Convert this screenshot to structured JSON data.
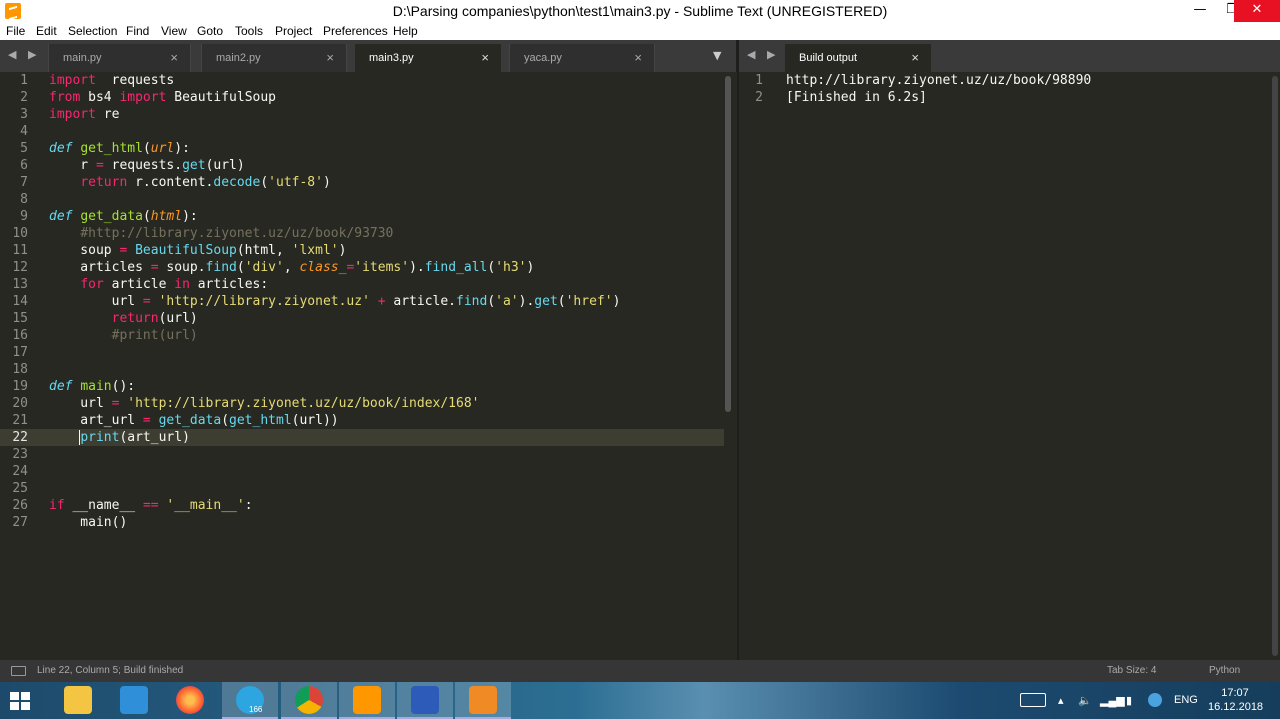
{
  "window": {
    "title": "D:\\Parsing companies\\python\\test1\\main3.py - Sublime Text (UNREGISTERED)",
    "minimize": "—",
    "maximize": "❐",
    "close": "✕"
  },
  "menu": [
    "File",
    "Edit",
    "Selection",
    "Find",
    "View",
    "Goto",
    "Tools",
    "Project",
    "Preferences",
    "Help"
  ],
  "tabs": [
    {
      "label": "main.py",
      "active": false
    },
    {
      "label": "main2.py",
      "active": false
    },
    {
      "label": "main3.py",
      "active": true
    },
    {
      "label": "yaca.py",
      "active": false
    }
  ],
  "tab_close": "×",
  "nav_arrows": "◀ ▶",
  "dropdown_arrow": "▼",
  "output_tab": {
    "label": "Build output"
  },
  "editor": {
    "current_line": 22,
    "lines": [
      [
        [
          "k",
          "import"
        ],
        [
          "",
          "  requests"
        ]
      ],
      [
        [
          "k",
          "from"
        ],
        [
          "",
          " bs4 "
        ],
        [
          "k",
          "import"
        ],
        [
          "",
          " BeautifulSoup"
        ]
      ],
      [
        [
          "k",
          "import"
        ],
        [
          "",
          " re"
        ]
      ],
      [],
      [
        [
          "d",
          "def"
        ],
        [
          "",
          " "
        ],
        [
          "f",
          "get_html"
        ],
        [
          "",
          "("
        ],
        [
          "p",
          "url"
        ],
        [
          "",
          "):"
        ]
      ],
      [
        [
          "",
          "    r "
        ],
        [
          "k",
          "="
        ],
        [
          "",
          " requests."
        ],
        [
          "b",
          "get"
        ],
        [
          "",
          "(url)"
        ]
      ],
      [
        [
          "",
          "    "
        ],
        [
          "k",
          "return"
        ],
        [
          "",
          " r.content."
        ],
        [
          "b",
          "decode"
        ],
        [
          "",
          "("
        ],
        [
          "s",
          "'utf-8'"
        ],
        [
          "",
          ")"
        ]
      ],
      [],
      [
        [
          "d",
          "def"
        ],
        [
          "",
          " "
        ],
        [
          "f",
          "get_data"
        ],
        [
          "",
          "("
        ],
        [
          "p",
          "html"
        ],
        [
          "",
          "):"
        ]
      ],
      [
        [
          "",
          "    "
        ],
        [
          "c",
          "#http://library.ziyonet.uz/uz/book/93730"
        ]
      ],
      [
        [
          "",
          "    soup "
        ],
        [
          "k",
          "="
        ],
        [
          "",
          " "
        ],
        [
          "b",
          "BeautifulSoup"
        ],
        [
          "",
          "(html, "
        ],
        [
          "s",
          "'lxml'"
        ],
        [
          "",
          ")"
        ]
      ],
      [
        [
          "",
          "    articles "
        ],
        [
          "k",
          "="
        ],
        [
          "",
          " soup."
        ],
        [
          "b",
          "find"
        ],
        [
          "",
          "("
        ],
        [
          "s",
          "'div'"
        ],
        [
          "",
          ", "
        ],
        [
          "p",
          "class_"
        ],
        [
          "k",
          "="
        ],
        [
          "s",
          "'items'"
        ],
        [
          "",
          ")."
        ],
        [
          "b",
          "find_all"
        ],
        [
          "",
          "("
        ],
        [
          "s",
          "'h3'"
        ],
        [
          "",
          ")"
        ]
      ],
      [
        [
          "",
          "    "
        ],
        [
          "k",
          "for"
        ],
        [
          "",
          " article "
        ],
        [
          "k",
          "in"
        ],
        [
          "",
          " articles:"
        ]
      ],
      [
        [
          "",
          "        url "
        ],
        [
          "k",
          "="
        ],
        [
          "",
          " "
        ],
        [
          "s",
          "'http://library.ziyonet.uz'"
        ],
        [
          "",
          " "
        ],
        [
          "k",
          "+"
        ],
        [
          "",
          " article."
        ],
        [
          "b",
          "find"
        ],
        [
          "",
          "("
        ],
        [
          "s",
          "'a'"
        ],
        [
          "",
          ")."
        ],
        [
          "b",
          "get"
        ],
        [
          "",
          "("
        ],
        [
          "s",
          "'href'"
        ],
        [
          "",
          ")"
        ]
      ],
      [
        [
          "",
          "        "
        ],
        [
          "k",
          "return"
        ],
        [
          "",
          "(url)"
        ]
      ],
      [
        [
          "",
          "        "
        ],
        [
          "c",
          "#print(url)"
        ]
      ],
      [],
      [],
      [
        [
          "d",
          "def"
        ],
        [
          "",
          " "
        ],
        [
          "f",
          "main"
        ],
        [
          "",
          "():"
        ]
      ],
      [
        [
          "",
          "    url "
        ],
        [
          "k",
          "="
        ],
        [
          "",
          " "
        ],
        [
          "s",
          "'http://library.ziyonet.uz/uz/book/index/168'"
        ]
      ],
      [
        [
          "",
          "    art_url "
        ],
        [
          "k",
          "="
        ],
        [
          "",
          " "
        ],
        [
          "b",
          "get_data"
        ],
        [
          "",
          "("
        ],
        [
          "b",
          "get_html"
        ],
        [
          "",
          "(url))"
        ]
      ],
      [
        [
          "",
          "    "
        ],
        [
          "b",
          "print"
        ],
        [
          "",
          "(art_url)"
        ]
      ],
      [],
      [],
      [],
      [
        [
          "k",
          "if"
        ],
        [
          "",
          " __name__ "
        ],
        [
          "k",
          "=="
        ],
        [
          "",
          " "
        ],
        [
          "s",
          "'__main__'"
        ],
        [
          "",
          ":"
        ]
      ],
      [
        [
          "",
          "    main()"
        ]
      ]
    ]
  },
  "output": {
    "lines": [
      "http://library.ziyonet.uz/uz/book/98890",
      "[Finished in 6.2s]"
    ]
  },
  "status": {
    "position": "Line 22, Column 5; Build finished",
    "tab_size": "Tab Size: 4",
    "syntax": "Python"
  },
  "taskbar": {
    "apps": [
      "file-explorer-icon",
      "network-icon",
      "firefox-icon",
      "telegram-icon",
      "chrome-icon",
      "sublime-text-icon",
      "save-app-icon",
      "pdf-app-icon"
    ],
    "telegram_badge": "166",
    "language": "ENG",
    "time": "17:07",
    "date": "16.12.2018"
  }
}
